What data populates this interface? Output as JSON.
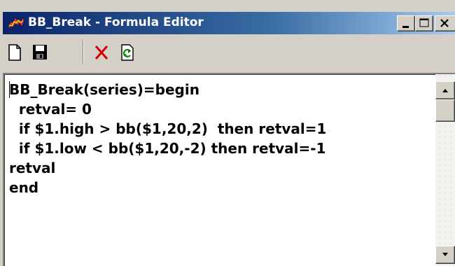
{
  "window": {
    "title": "BB_Break - Formula Editor",
    "icon": "chart-app-icon",
    "caption_buttons": [
      "minimize-icon",
      "maximize-icon",
      "close-icon"
    ]
  },
  "toolbar": {
    "buttons": [
      {
        "name": "new-document",
        "icon": "new-document-icon"
      },
      {
        "name": "save",
        "icon": "floppy-disk-icon"
      },
      {
        "name": "delete",
        "icon": "red-x-icon"
      },
      {
        "name": "refresh",
        "icon": "refresh-icon"
      }
    ]
  },
  "editor": {
    "lines": [
      "BB_Break(series)=begin",
      "  retval= 0",
      "  if $1.high > bb($1,20,2)  then retval=1",
      "  if $1.low < bb($1,20,-2) then retval=-1",
      "retval",
      "end"
    ]
  },
  "colors": {
    "titlebar_start": "#0a246a",
    "titlebar_end": "#a6caf0",
    "window_face": "#d4d0c8",
    "delete_icon": "#d40000"
  }
}
